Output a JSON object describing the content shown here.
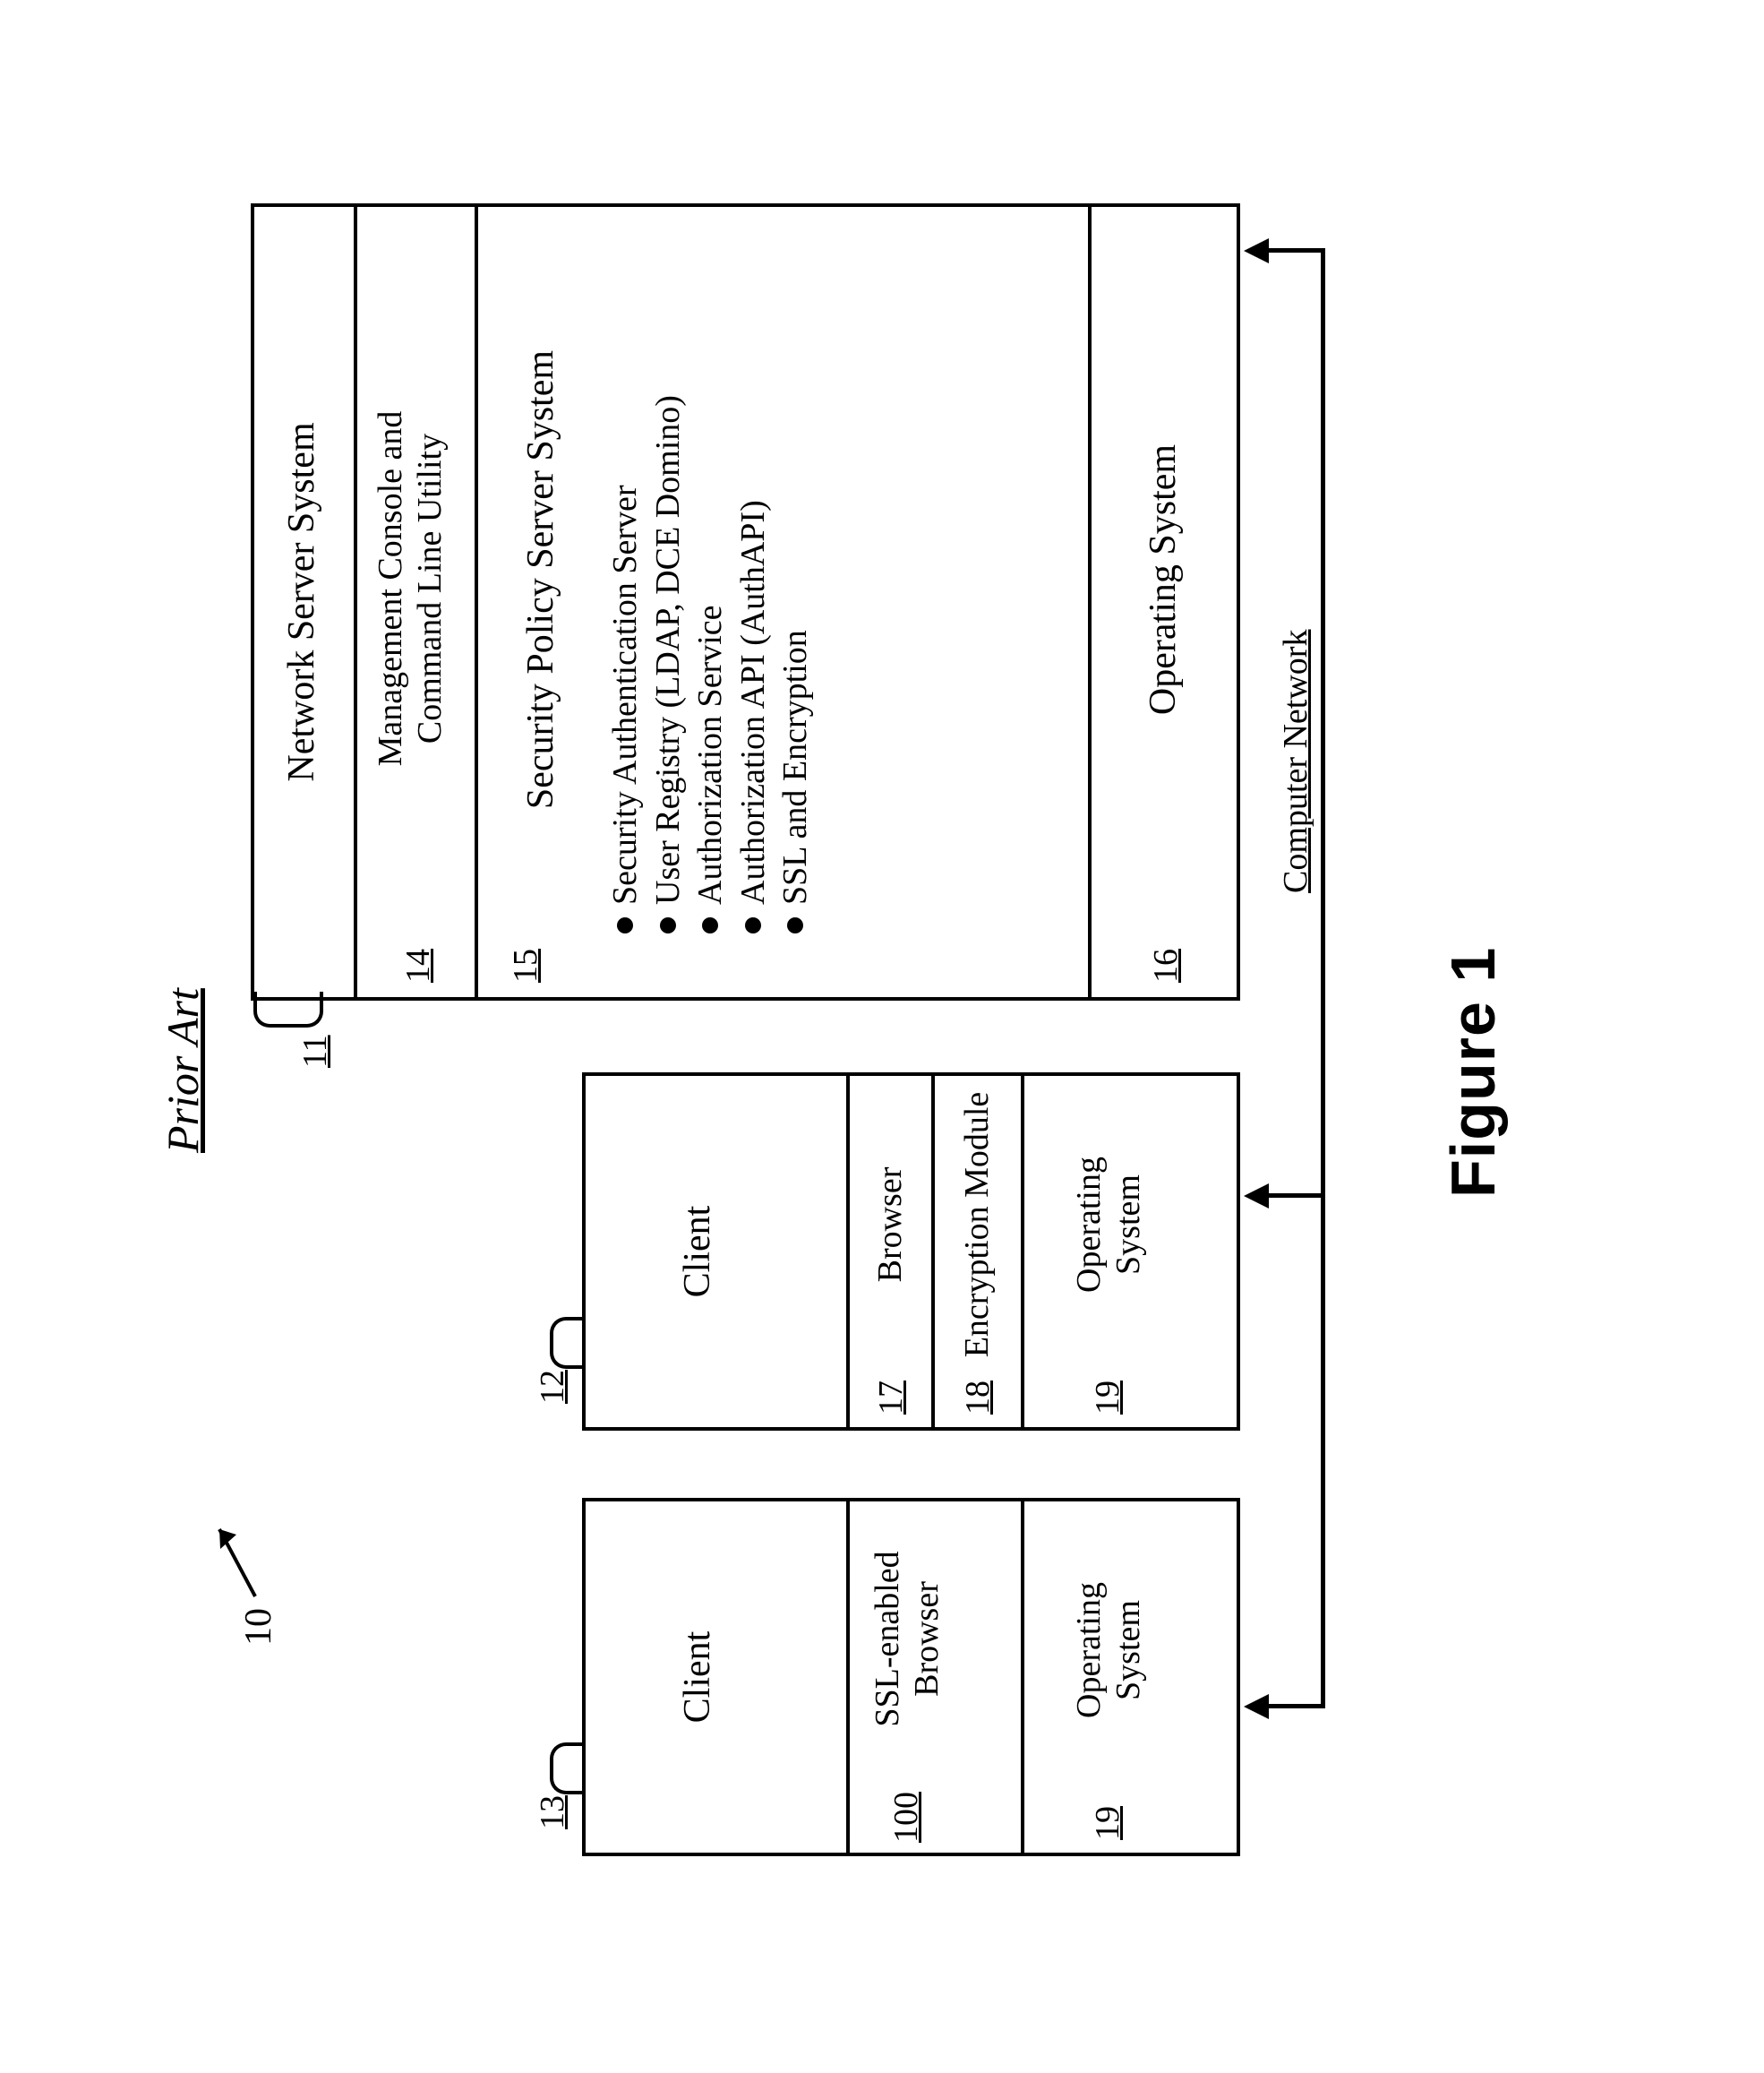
{
  "title": "Prior Art",
  "figure_label": "Figure 1",
  "refs": {
    "diagram": "10",
    "server": "11",
    "client_a": "12",
    "client_b": "13",
    "mgmt": "14",
    "policy": "15",
    "server_os": "16",
    "browser": "17",
    "enc_module": "18",
    "client_os_a": "19",
    "client_os_b": "19",
    "ssl_browser": "100"
  },
  "server": {
    "title": "Network Server System",
    "mgmt": "Management Console and\nCommand Line Utility",
    "policy_title": "Security Policy  Server System",
    "bullets": [
      "Security Authentication  Server",
      "User Registry (LDAP, DCE Domino)",
      "Authorization Service",
      "Authorization API (AuthAPI)",
      "SSL and Encryption"
    ],
    "os": "Operating System"
  },
  "client_a": {
    "title": "Client",
    "browser": "Browser",
    "enc": "Encryption Module",
    "os": "Operating\nSystem"
  },
  "client_b": {
    "title": "Client",
    "ssl_browser": "SSL-enabled\nBrowser",
    "os": "Operating\nSystem"
  },
  "network_label": "Computer Network"
}
